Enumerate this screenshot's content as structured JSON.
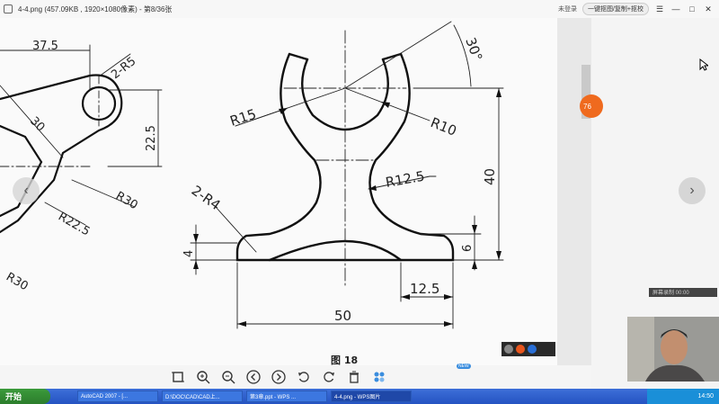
{
  "window": {
    "title": "4-4.png (457.09KB , 1920×1080像素) - 第8/36张",
    "header_pill": "一键抠图/复制+抠校",
    "header_left": "未登录",
    "controls": [
      "☰",
      "—",
      "□",
      "✕"
    ]
  },
  "drawing": {
    "dimensions": {
      "d_37_5": "37.5",
      "d_2_r5": "2-R5",
      "d_30_left": "30",
      "d_22_5": "22.5",
      "d_r30_a": "R30",
      "d_r22_5": "R22.5",
      "d_r30_b": "R30",
      "d_r15": "R15",
      "d_r10": "R10",
      "d_30_deg": "30°",
      "d_r12_5": "R12.5",
      "d_40": "40",
      "d_2_r4": "2-R4",
      "d_4": "4",
      "d_6": "6",
      "d_12_5": "12.5",
      "d_50": "50",
      "caption": "图 18"
    }
  },
  "side": {
    "badge": "76"
  },
  "toolbar": {
    "new_label": "NEW"
  },
  "webcam": {
    "label": "屏幕录制 00:00"
  },
  "taskbar": {
    "start": "开始",
    "tasks": [
      "AutoCAD 2007 - [...",
      "D:\\DOC\\CAD\\CAD上...",
      "第3章.ppt - WPS ...",
      "4-4.png - WPS图片"
    ],
    "clock": "14:50"
  }
}
